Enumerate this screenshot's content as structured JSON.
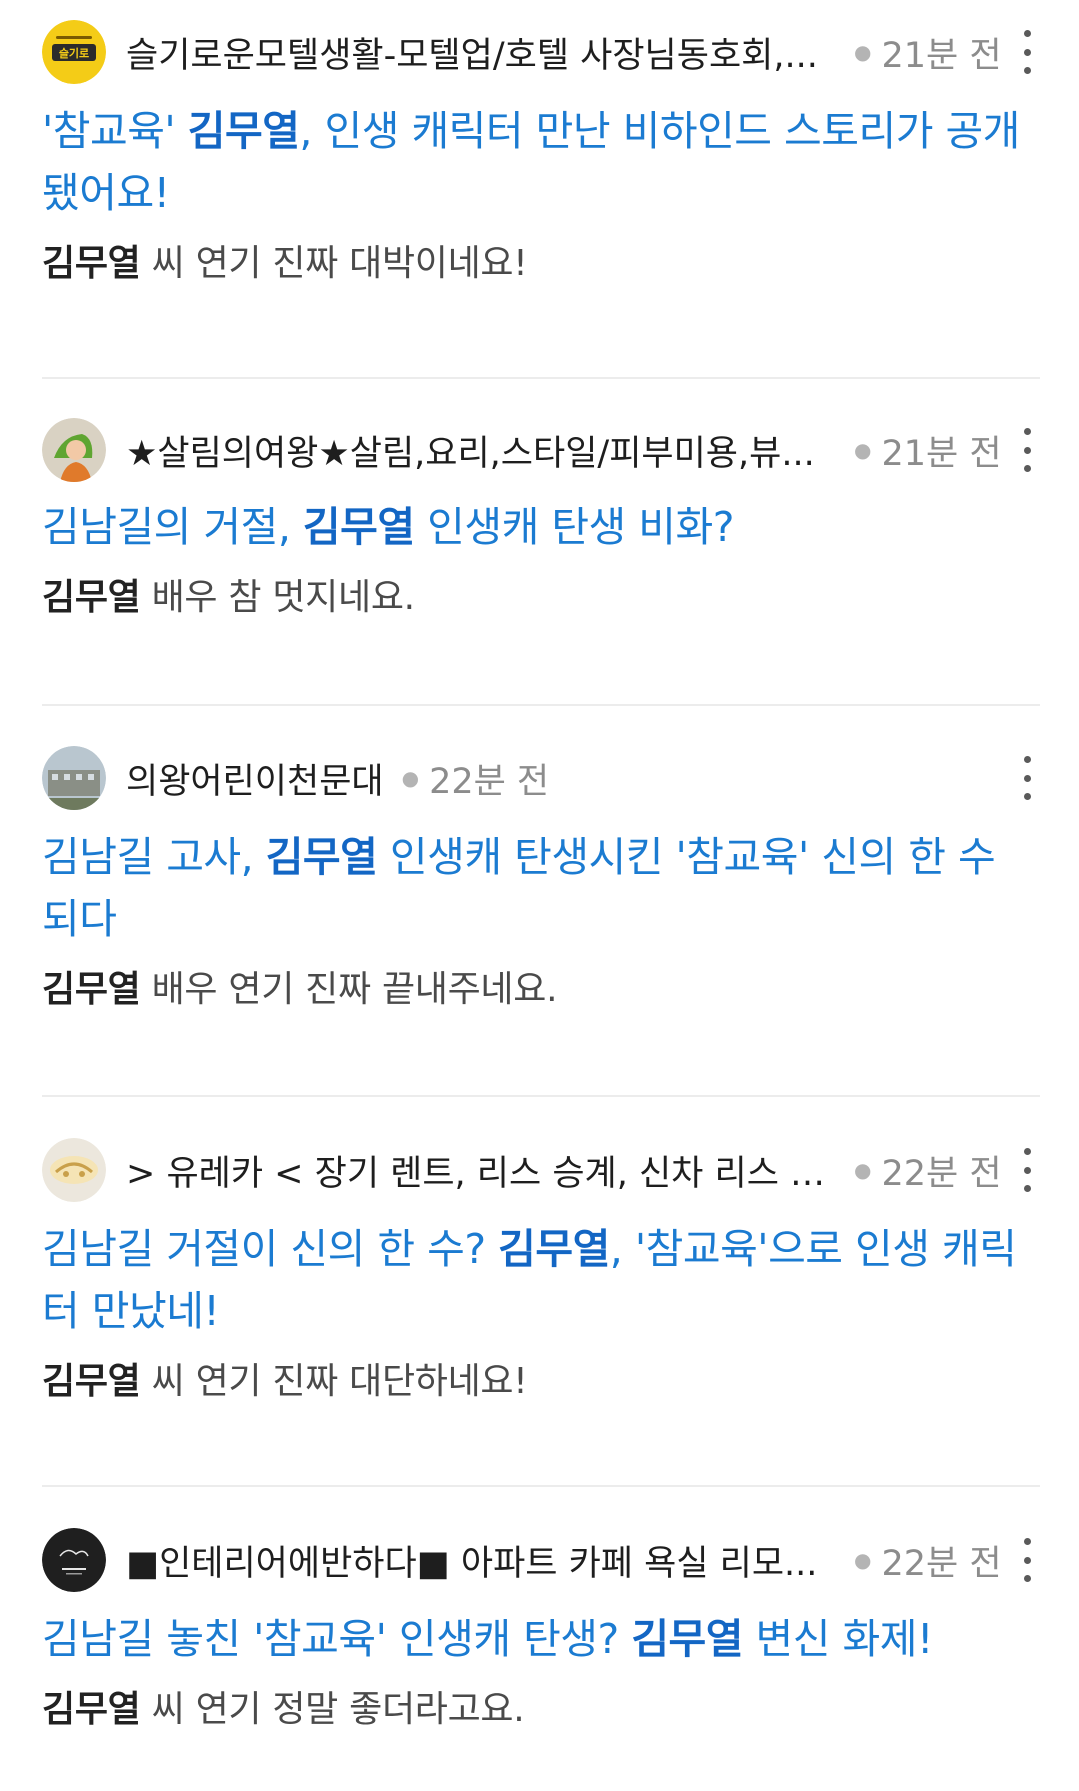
{
  "feed": [
    {
      "source": "슬기로운모텔생활-모텔업/호텔 사장님동호회,...",
      "time": "21분 전",
      "avatar_text": "슬기로",
      "title": {
        "pre": "'참교육' ",
        "bold": "김무열",
        "post": ", 인생 캐릭터 만난 비하인드 스토리가 공개됐어요!"
      },
      "snippet": {
        "bold": "김무열",
        "rest": " 씨 연기 진짜 대박이네요!"
      }
    },
    {
      "source": "★살림의여왕★살림,요리,스타일/피부미용,뷰...",
      "time": "21분 전",
      "title": {
        "pre": "김남길의 거절, ",
        "bold": "김무열",
        "post": " 인생캐 탄생 비화?"
      },
      "snippet": {
        "bold": "김무열",
        "rest": " 배우 참 멋지네요."
      }
    },
    {
      "source": "의왕어린이천문대",
      "time": "22분 전",
      "title": {
        "pre": "김남길 고사, ",
        "bold": "김무열",
        "post": " 인생캐 탄생시킨 '참교육' 신의 한 수 되다"
      },
      "snippet": {
        "bold": "김무열",
        "rest": " 배우 연기 진짜 끝내주네요."
      }
    },
    {
      "source": "> 유레카 < 장기 렌트, 리스 승계, 신차 리스 차...",
      "time": "22분 전",
      "title": {
        "pre": "김남길 거절이 신의 한 수? ",
        "bold": "김무열",
        "post": ", '참교육'으로 인생 캐릭터 만났네!"
      },
      "snippet": {
        "bold": "김무열",
        "rest": " 씨 연기 진짜 대단하네요!"
      }
    },
    {
      "source": "■인테리어에반하다■ 아파트 카페 욕실 리모...",
      "time": "22분 전",
      "title": {
        "pre": "김남길 놓친 '참교육' 인생캐 탄생? ",
        "bold": "김무열",
        "post": " 변신 화제!"
      },
      "snippet": {
        "bold": "김무열",
        "rest": " 씨 연기 정말 좋더라고요."
      }
    }
  ],
  "colors": {
    "title_link": "#1b7bd1",
    "title_keyword": "#1366c4",
    "source_text": "#1e1e1e",
    "time_text": "#8c8c8c",
    "divider": "#ececec"
  },
  "icons": {
    "more": "more-vertical-icon"
  }
}
